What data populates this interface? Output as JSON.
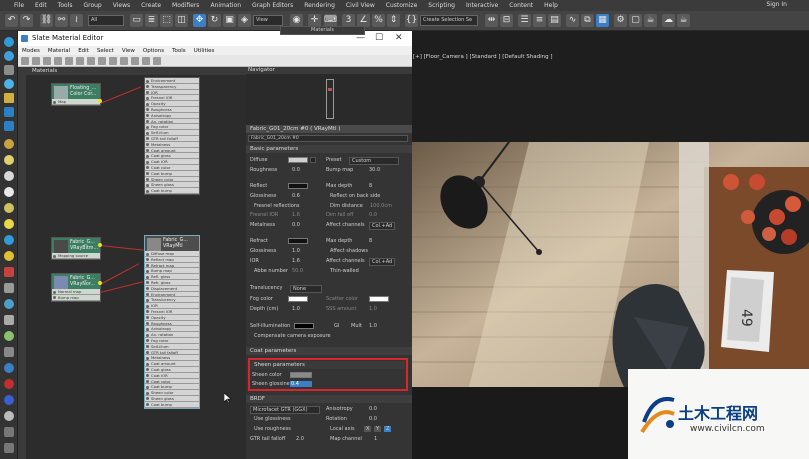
{
  "menubar": {
    "items": [
      "File",
      "Edit",
      "Tools",
      "Group",
      "Views",
      "Create",
      "Modifiers",
      "Animation",
      "Graph Editors",
      "Rendering",
      "Civil View",
      "Customize",
      "Scripting",
      "Interactive",
      "Content",
      "Help"
    ],
    "signin": "Sign In"
  },
  "toolbar": {
    "filter_value": "All",
    "refcoord_value": "View",
    "selection_set_placeholder": "Create Selection Se"
  },
  "sme": {
    "title": "Slate Material Editor",
    "menu": [
      "Modes",
      "Material",
      "Edit",
      "Select",
      "View",
      "Options",
      "Tools",
      "Utilities"
    ],
    "panel_tab": "Materials",
    "view_dropdown": "Materials",
    "navigator": "Navigator"
  },
  "nodes": {
    "n1": {
      "title_a": "Floating_...",
      "title_b": "Color Cor...",
      "slots": [
        "Map"
      ]
    },
    "big1": {
      "slots": [
        "Environment",
        "Transparency",
        "IOR",
        "Fresnel IOR",
        "Opacity",
        "Roughness",
        "Anisotropy",
        "An. rotation",
        "Fog color",
        "Self-illum",
        "GTR tail falloff",
        "Metalness",
        "Coat amount",
        "Coat gloss",
        "Coat IOR",
        "Coat color",
        "Coat bump",
        "Sheen color",
        "Sheen gloss",
        "Coat bump"
      ]
    },
    "n2": {
      "title_a": "Fabric_G...",
      "title_b": "VRayBitm...",
      "slots": [
        "Mapping source"
      ]
    },
    "n3": {
      "title_a": "Fabric_G...",
      "title_b": "VRayNor...",
      "slots": [
        "Normal map",
        "Bump map"
      ]
    },
    "big2": {
      "title_a": "Fabric_G...",
      "title_b": "VRayMtl",
      "slots": [
        "Diffuse map",
        "Reflect map",
        "Refract map",
        "Bump map",
        "Refl. gloss",
        "Refr. gloss",
        "Displacement",
        "Environment",
        "Translucency",
        "IOR",
        "Fresnel IOR",
        "Opacity",
        "Roughness",
        "Anisotropy",
        "An. rotation",
        "Fog color",
        "Self-illum",
        "GTR tail falloff",
        "Metalness",
        "Coat amount",
        "Coat gloss",
        "Coat IOR",
        "Coat color",
        "Coat bump",
        "Sheen color",
        "Sheen gloss",
        "Coat bump"
      ]
    }
  },
  "props": {
    "title": "Fabric_G01_20cm #0  ( VRayMtl )",
    "name_field": "Fabric_G01_20cm #0",
    "basic": "Basic parameters",
    "diffuse": "Diffuse",
    "roughness": "Roughness",
    "roughness_val": "0.0",
    "preset": "Preset",
    "preset_val": "Custom",
    "bump_map": "Bump map",
    "bump_val": "30.0",
    "reflect": "Reflect",
    "max_depth": "Max depth",
    "max_depth_val": "8",
    "glossiness": "Glossiness",
    "glossiness_val": "0.6",
    "reflect_backside": "Reflect on back side",
    "fresnel": "Fresnel reflections",
    "dim_distance": "Dim distance",
    "dim_distance_val": "100.0cm",
    "fresnel_ior": "Fresnel IOR",
    "fresnel_ior_val": "1.6",
    "dim_falloff": "Dim fall off",
    "dim_falloff_val": "0.0",
    "metalness": "Metalness",
    "metalness_val": "0.0",
    "affect_channels": "Affect channels",
    "affect_val": "Col.+Ad",
    "refract": "Refract",
    "max_depth2_val": "8",
    "glossiness2_val": "1.0",
    "affect_shadows": "Affect shadows",
    "ior": "IOR",
    "ior_val": "1.6",
    "affect_channels2": "Affect channels",
    "affect2_val": "Col.+Ad",
    "abbe": "Abbe number",
    "abbe_val": "50.0",
    "thin_walled": "Thin-walled",
    "translucency": "Translucency",
    "translucency_val": "None",
    "fog_color": "Fog color",
    "scatter_color": "Scatter color",
    "depth": "Depth (cm)",
    "depth_val": "1.0",
    "sss_amount": "SSS amount",
    "sss_val": "1.0",
    "self_illum": "Self-illumination",
    "gi": "GI",
    "mult": "Mult",
    "mult_val": "1.0",
    "comp_exposure": "Compensate camera exposure",
    "coat": "Coat parameters",
    "sheen": "Sheen parameters",
    "sheen_color": "Sheen color",
    "sheen_gloss": "Sheen glossiness",
    "sheen_gloss_val": "0.4",
    "brdf": "BRDF",
    "brdf_val": "Microfacet GTR (GGX)",
    "anisotropy": "Anisotropy",
    "anisotropy_val": "0.0",
    "use_gloss": "Use glossiness",
    "rotation": "Rotation",
    "rotation_val": "0.0",
    "use_rough": "Use roughness",
    "local_axis": "Local axis",
    "axes": [
      "X",
      "Y",
      "Z"
    ],
    "gtr_tail": "GTR tail falloff",
    "gtr_val": "2.0",
    "map_channel": "Map channel",
    "map_channel_val": "1"
  },
  "viewport": {
    "label": "[+] [Floor_Camera ] [Standard ] [Default Shading ]",
    "book_number": "49"
  },
  "watermark": {
    "cn": "土木工程网",
    "url": "www.civilcn.com"
  },
  "colors": {
    "accent": "#3b7fc4",
    "highlight_box": "#d8262e",
    "node_green": "#3d7d62"
  }
}
